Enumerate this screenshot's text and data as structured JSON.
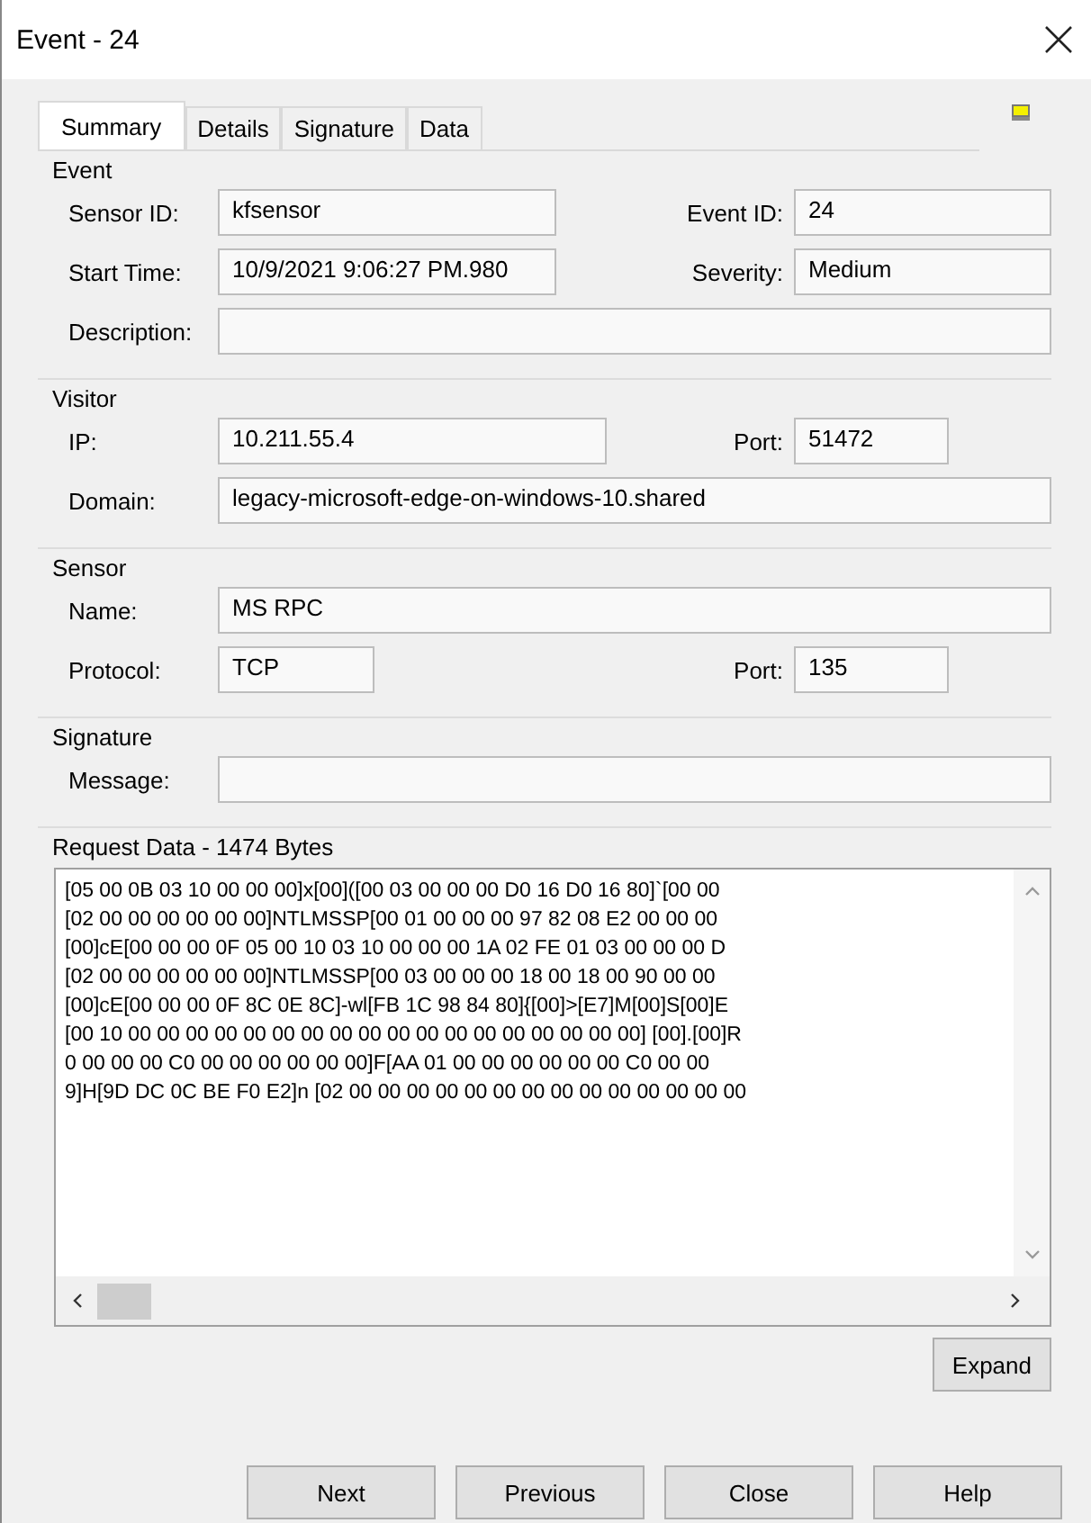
{
  "window": {
    "title": "Event - 24"
  },
  "tabs": [
    {
      "label": "Summary",
      "selected": true
    },
    {
      "label": "Details",
      "selected": false
    },
    {
      "label": "Signature",
      "selected": false
    },
    {
      "label": "Data",
      "selected": false
    }
  ],
  "sections": [
    {
      "title": "Event",
      "rows": [
        [
          {
            "label": "Sensor ID:",
            "value": "kfsensor"
          },
          {
            "label": "Event ID:",
            "value": "24"
          }
        ],
        [
          {
            "label": "Start Time:",
            "value": "10/9/2021 9:06:27 PM.980"
          },
          {
            "label": "Severity:",
            "value": "Medium"
          }
        ],
        [
          {
            "label": "Description:"
          }
        ]
      ]
    },
    {
      "title": "Visitor",
      "rows": [
        [
          {
            "label": "IP:",
            "value": "10.211.55.4"
          },
          {
            "label": "Port:",
            "value": "51472"
          }
        ],
        [
          {
            "label": "Domain:",
            "value": "legacy-microsoft-edge-on-windows-10.shared"
          }
        ]
      ]
    },
    {
      "title": "Sensor",
      "rows": [
        [
          {
            "label": "Name:",
            "value": "MS RPC"
          }
        ],
        [
          {
            "label": "Protocol:",
            "value": "TCP"
          },
          {
            "label": "Port:",
            "value": "135"
          }
        ]
      ]
    },
    {
      "title": "Signature",
      "rows": [
        [
          {
            "label": "Message:"
          }
        ]
      ]
    }
  ],
  "request_data": {
    "title": "Request Data - 1474 Bytes",
    "lines": [
      "[05 00 0B 03 10 00 00 00]x[00]([00 03 00 00 00 D0 16 D0 16 80]`[00 00",
      "[02 00 00 00 00 00 00]NTLMSSP[00 01 00 00 00 97 82 08 E2 00 00 00",
      "[00]cE[00 00 00 0F 05 00 10 03 10 00 00 00 1A 02 FE 01 03 00 00 00 D",
      "[02 00 00 00 00 00 00]NTLMSSP[00 03 00 00 00 18 00 18 00 90 00 00",
      "[00]cE[00 00 00 0F 8C 0E 8C]-wl[FB 1C 98 84 80]{[00]>[E7]M[00]S[00]E",
      "[00 10 00 00 00 00 00 00 00 00 00 00 00 00 00 00 00 00 00 00] [00].[00]R",
      "0 00 00 00 C0 00 00 00 00 00 00]F[AA 01 00 00 00 00 00 00 C0 00 00",
      "9]H[9D DC 0C BE F0 E2]n [02 00 00 00 00 00 00 00 00 00 00 00 00 00 00"
    ],
    "expand_button": "Expand"
  },
  "buttons": [
    "Next",
    "Previous",
    "Close",
    "Help"
  ]
}
